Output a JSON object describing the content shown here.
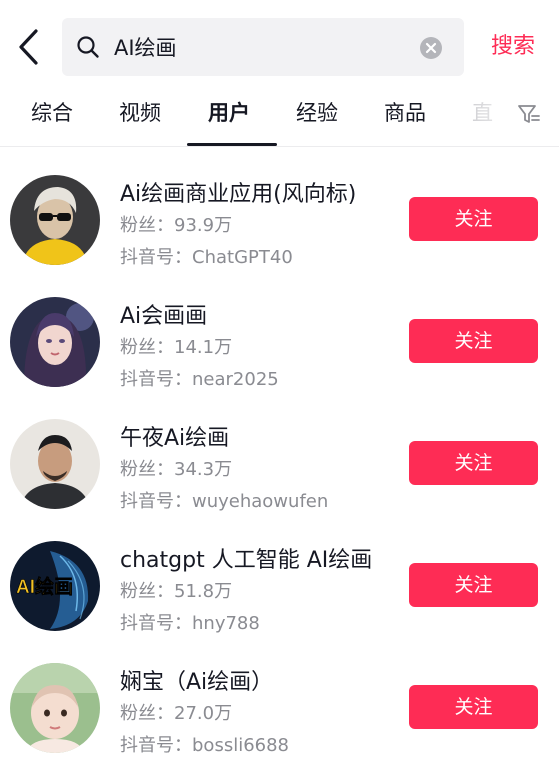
{
  "search": {
    "query": "AI绘画",
    "submit_label": "搜索"
  },
  "tabs": [
    {
      "label": "综合"
    },
    {
      "label": "视频"
    },
    {
      "label": "用户"
    },
    {
      "label": "经验"
    },
    {
      "label": "商品"
    },
    {
      "label": "直"
    }
  ],
  "active_tab": "用户",
  "accent_color": "#fe2c55",
  "users": [
    {
      "name": "Ai绘画商业应用(风向标)",
      "fans_label": "粉丝：",
      "fans": "93.9万",
      "id_label": "抖音号：",
      "douyin_id": "ChatGPT40",
      "follow_label": "关注"
    },
    {
      "name": "Ai会画画",
      "fans_label": "粉丝：",
      "fans": "14.1万",
      "id_label": "抖音号：",
      "douyin_id": "near2025",
      "follow_label": "关注"
    },
    {
      "name": "午夜Ai绘画",
      "fans_label": "粉丝：",
      "fans": "34.3万",
      "id_label": "抖音号：",
      "douyin_id": "wuyehaowufen",
      "follow_label": "关注"
    },
    {
      "name": "chatgpt 人工智能 AI绘画",
      "fans_label": "粉丝：",
      "fans": "51.8万",
      "id_label": "抖音号：",
      "douyin_id": "hny788",
      "follow_label": "关注",
      "avatar_text": "AI绘画"
    },
    {
      "name": "娴宝（Ai绘画）",
      "fans_label": "粉丝：",
      "fans": "27.0万",
      "id_label": "抖音号：",
      "douyin_id": "bossli6688",
      "follow_label": "关注"
    }
  ]
}
